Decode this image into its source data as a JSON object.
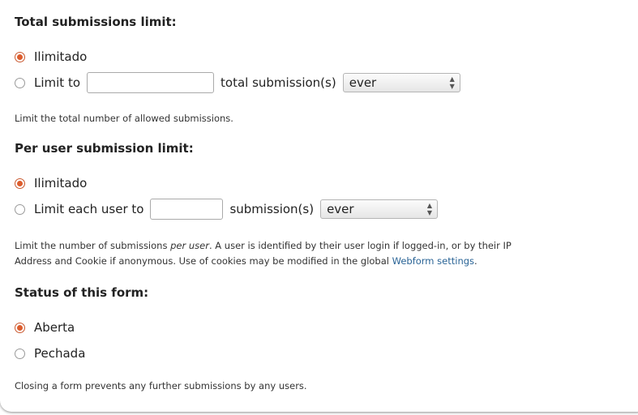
{
  "total": {
    "heading": "Total submissions limit:",
    "option_unlimited": "Ilimitado",
    "option_limit_prefix": "Limit to",
    "input_value": "",
    "option_limit_suffix": "total submission(s)",
    "interval_selected": "ever",
    "description": "Limit the total number of allowed submissions."
  },
  "per_user": {
    "heading": "Per user submission limit:",
    "option_unlimited": "Ilimitado",
    "option_limit_prefix": "Limit each user to",
    "input_value": "",
    "option_limit_suffix": "submission(s)",
    "interval_selected": "ever",
    "description_1": "Limit the number of submissions ",
    "description_em": "per user",
    "description_2": ". A user is identified by their user login if logged-in, or by their IP",
    "description_3": "Address and Cookie if anonymous. Use of cookies may be modified in the global ",
    "description_link": "Webform settings",
    "description_4": "."
  },
  "status": {
    "heading": "Status of this form:",
    "option_open": "Aberta",
    "option_closed": "Pechada",
    "description": "Closing a form prevents any further submissions by any users."
  },
  "colors": {
    "radio_checked": "#dd5d2d",
    "link": "#2a6496"
  }
}
